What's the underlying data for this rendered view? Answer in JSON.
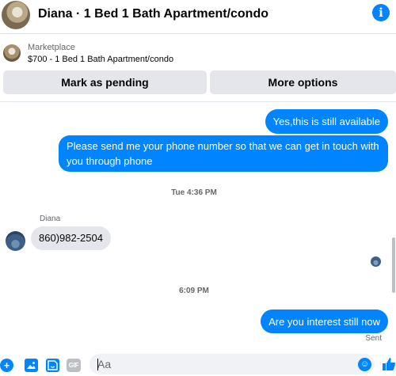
{
  "header": {
    "title": "Diana · 1 Bed 1 Bath Apartment/condo",
    "info_icon": "info-icon"
  },
  "listing": {
    "source": "Marketplace",
    "title": "$700 - 1 Bed 1 Bath Apartment/condo",
    "mark_pending_label": "Mark as pending",
    "more_options_label": "More options"
  },
  "conversation": {
    "messages": [
      {
        "from": "me",
        "text": "Yes,this is still available"
      },
      {
        "from": "me",
        "text": "Please send me your phone  number so that we can get in touch with you through phone"
      },
      {
        "type": "timestamp",
        "text": "Tue 4:36 PM"
      },
      {
        "from": "Diana",
        "sender_label": "Diana",
        "text": "860)982-2504"
      },
      {
        "type": "timestamp",
        "text": "6:09 PM"
      },
      {
        "from": "me",
        "text": "Are you interest still now",
        "status": "Sent"
      }
    ]
  },
  "composer": {
    "placeholder": "Aa",
    "icons": [
      "plus-icon",
      "photo-icon",
      "sticker-icon",
      "gif-icon",
      "emoji-icon",
      "like-icon"
    ],
    "gif_label": "GIF"
  },
  "colors": {
    "accent": "#0084ff",
    "bubble_in": "#e4e6eb",
    "button_bg": "#e4e6eb",
    "muted_text": "#65676b"
  }
}
